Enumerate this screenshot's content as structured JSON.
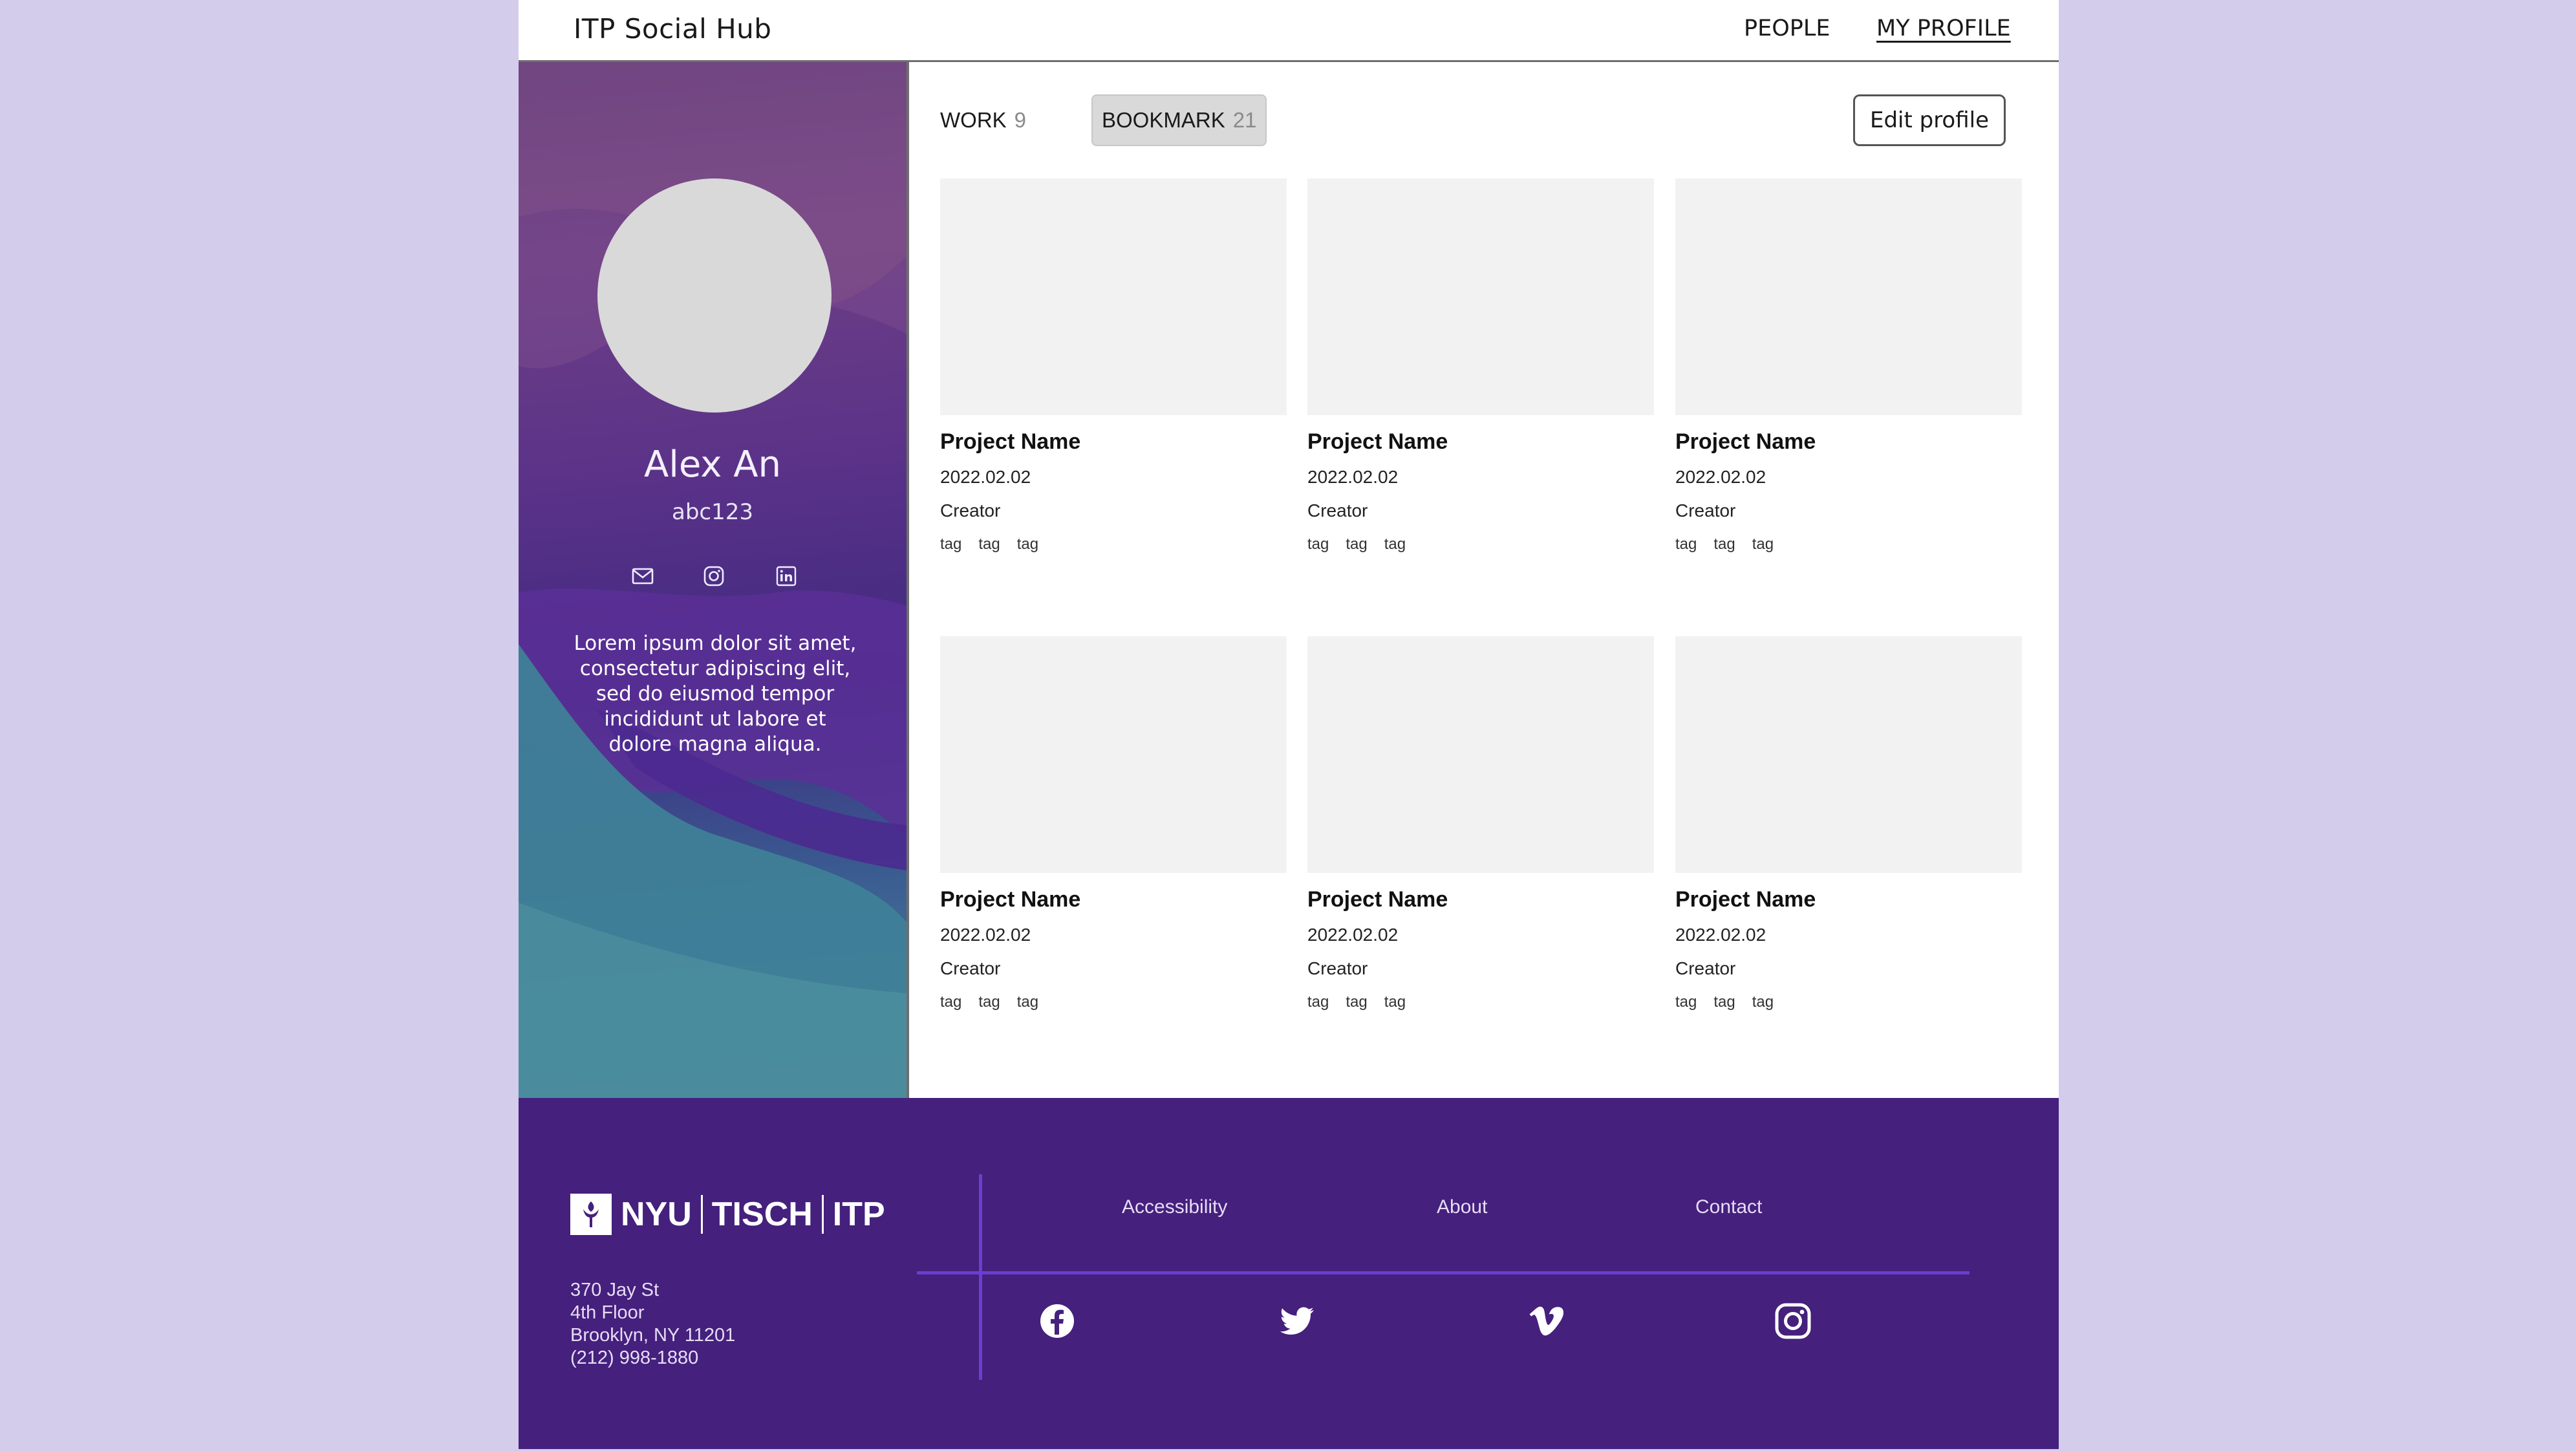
{
  "header": {
    "app_title": "ITP Social Hub",
    "nav": [
      {
        "label": "PEOPLE"
      },
      {
        "label": "MY PROFILE",
        "active": true
      }
    ]
  },
  "profile": {
    "name": "Alex An",
    "handle": "abc123",
    "social_icons": [
      "mail-icon",
      "instagram-icon",
      "linkedin-icon"
    ],
    "bio": "Lorem ipsum dolor sit amet, consectetur adipiscing elit, sed do eiusmod tempor incididunt ut labore et dolore magna aliqua."
  },
  "tabs": [
    {
      "label": "WORK",
      "count": "9"
    },
    {
      "label": "BOOKMARK",
      "count": "21",
      "selected": true
    }
  ],
  "edit_profile_label": "Edit profile",
  "projects": [
    {
      "name": "Project Name",
      "date": "2022.02.02",
      "creator": "Creator",
      "tags": [
        "tag",
        "tag",
        "tag"
      ]
    },
    {
      "name": "Project Name",
      "date": "2022.02.02",
      "creator": "Creator",
      "tags": [
        "tag",
        "tag",
        "tag"
      ]
    },
    {
      "name": "Project Name",
      "date": "2022.02.02",
      "creator": "Creator",
      "tags": [
        "tag",
        "tag",
        "tag"
      ]
    },
    {
      "name": "Project Name",
      "date": "2022.02.02",
      "creator": "Creator",
      "tags": [
        "tag",
        "tag",
        "tag"
      ]
    },
    {
      "name": "Project Name",
      "date": "2022.02.02",
      "creator": "Creator",
      "tags": [
        "tag",
        "tag",
        "tag"
      ]
    },
    {
      "name": "Project Name",
      "date": "2022.02.02",
      "creator": "Creator",
      "tags": [
        "tag",
        "tag",
        "tag"
      ]
    }
  ],
  "footer": {
    "logo": {
      "parts": [
        "NYU",
        "TISCH",
        "ITP"
      ]
    },
    "address": [
      "370 Jay St",
      "4th Floor",
      "Brooklyn, NY 11201",
      "(212) 998-1880"
    ],
    "links": [
      {
        "label": "Accessibility"
      },
      {
        "label": "About"
      },
      {
        "label": "Contact"
      }
    ],
    "social_icons": [
      "facebook-icon",
      "twitter-icon",
      "vimeo-icon",
      "instagram-icon"
    ]
  },
  "colors": {
    "page_background": "#d4cceb",
    "footer_background": "#45207c",
    "footer_divider": "#6a3fd0",
    "thumb_placeholder": "#f2f2f2"
  }
}
